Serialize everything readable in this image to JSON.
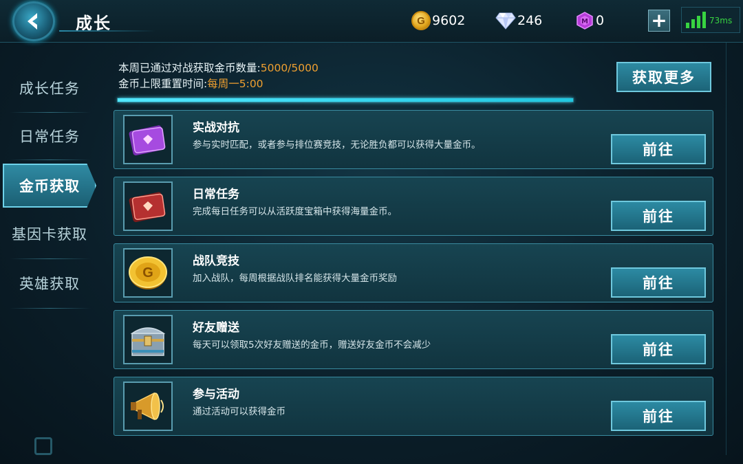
{
  "header": {
    "title": "成长",
    "gold": "9602",
    "diamonds": "246",
    "gems": "0",
    "gold_symbol": "G",
    "plus_label": "+",
    "latency": "73ms"
  },
  "sidebar": {
    "items": [
      {
        "label": "成长任务",
        "active": false
      },
      {
        "label": "日常任务",
        "active": false
      },
      {
        "label": "金币获取",
        "active": true
      },
      {
        "label": "基因卡获取",
        "active": false
      },
      {
        "label": "英雄获取",
        "active": false
      }
    ]
  },
  "summary": {
    "weekly_label": "本周已通过对战获取金币数量:",
    "weekly_value": "5000/5000",
    "weekly_progress": 1.0,
    "reset_label": "金币上限重置时间:",
    "reset_value": "每周一5:00",
    "more_button": "获取更多"
  },
  "tasks": [
    {
      "title": "实战对抗",
      "desc": "参与实时匹配，或者参与排位赛竞技，无论胜负都可以获得大量金币。",
      "button": "前往",
      "icon": "purple-ticket-icon"
    },
    {
      "title": "日常任务",
      "desc": "完成每日任务可以从活跃度宝箱中获得海量金币。",
      "button": "前往",
      "icon": "red-ticket-icon"
    },
    {
      "title": "战队竞技",
      "desc": "加入战队，每周根据战队排名能获得大量金币奖励",
      "button": "前往",
      "icon": "gold-coin-icon"
    },
    {
      "title": "好友赠送",
      "desc": "每天可以领取5次好友赠送的金币，赠送好友金币不会减少",
      "button": "前往",
      "icon": "treasure-chest-icon"
    },
    {
      "title": "参与活动",
      "desc": "通过活动可以获得金币",
      "button": "前往",
      "icon": "megaphone-icon"
    }
  ],
  "colors": {
    "accent": "#6fc9de",
    "highlight": "#f0a030",
    "signal": "#38d441"
  }
}
